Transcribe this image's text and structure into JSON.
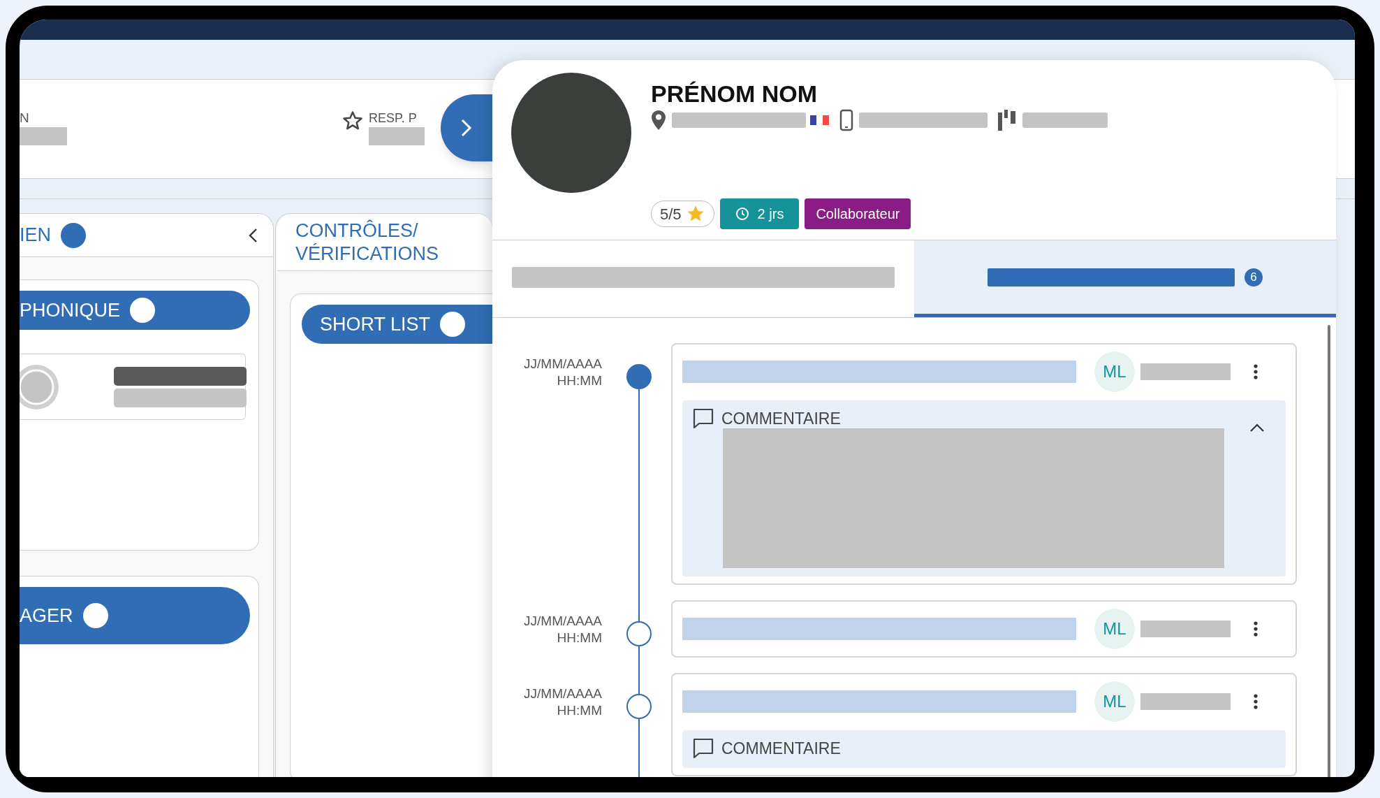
{
  "board": {
    "header_fields": [
      {
        "label": "N"
      },
      {
        "label": "RESP. P"
      }
    ],
    "columns": [
      {
        "title": "IEN",
        "cards": [
          {
            "title": "PHONIQUE",
            "kind": "list"
          },
          {
            "title": "AGER",
            "kind": "pill"
          }
        ]
      },
      {
        "title": "CONTRÔLES/ VÉRIFICATIONS",
        "cards": [
          {
            "title": "SHORT LIST",
            "kind": "pill"
          }
        ]
      }
    ]
  },
  "profile": {
    "name": "PRÉNOM NOM",
    "badges": [
      {
        "kind": "rating",
        "label": "5/5"
      },
      {
        "kind": "duration",
        "label": "2 jrs",
        "color": "#16929a"
      },
      {
        "kind": "role",
        "label": "Collaborateur",
        "color": "#8b1c85"
      }
    ],
    "tabs": [
      {
        "selected": false
      },
      {
        "selected": true,
        "count": "6"
      }
    ],
    "timeline": [
      {
        "date": "JJ/MM/AAAA",
        "time": "HH:MM",
        "current": true,
        "initials": "ML",
        "comment": {
          "label": "COMMENTAIRE",
          "expanded": true
        }
      },
      {
        "date": "JJ/MM/AAAA",
        "time": "HH:MM",
        "current": false,
        "initials": "ML"
      },
      {
        "date": "JJ/MM/AAAA",
        "time": "HH:MM",
        "current": false,
        "initials": "ML",
        "comment": {
          "label": "COMMENTAIRE"
        }
      }
    ]
  }
}
